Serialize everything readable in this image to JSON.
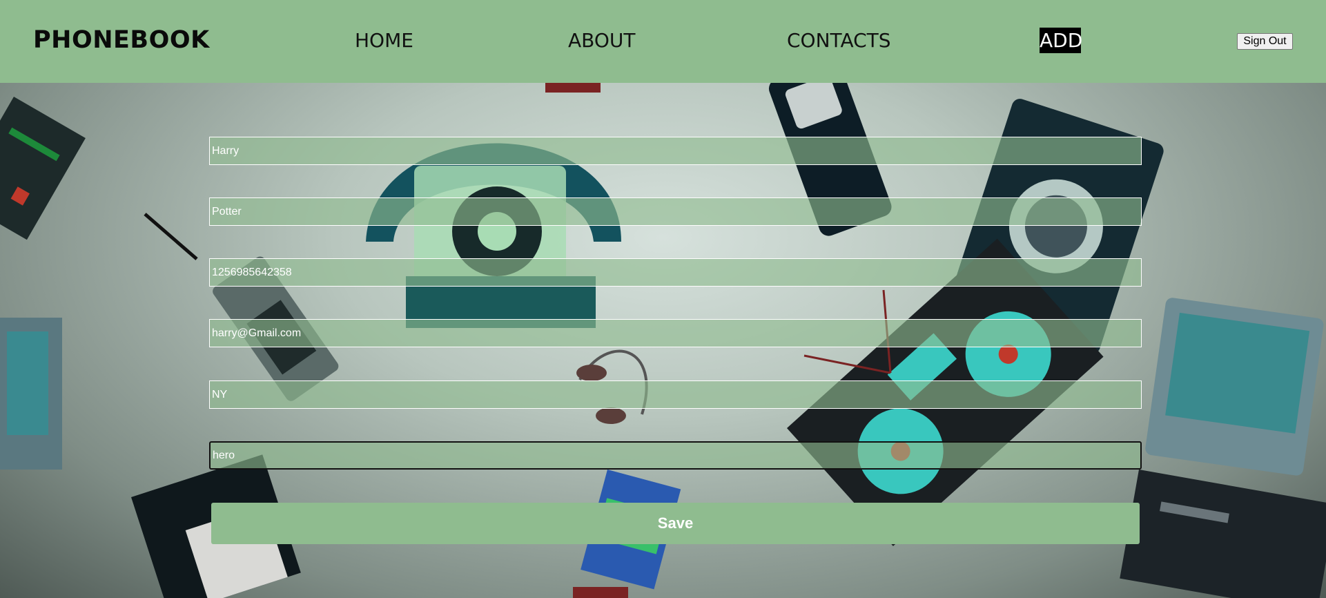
{
  "navbar": {
    "brand": "PHONEBOOK",
    "links": [
      "HOME",
      "ABOUT",
      "CONTACTS",
      "ADD"
    ],
    "active": "ADD",
    "signout_label": "Sign Out"
  },
  "form": {
    "first_name": "Harry",
    "last_name": "Potter",
    "phone": "1256985642358",
    "email": "harry@Gmail.com",
    "city": "NY",
    "notes": "hero",
    "save_label": "Save"
  },
  "colors": {
    "accent": "#8fbc8f",
    "active_bg": "#000000"
  }
}
